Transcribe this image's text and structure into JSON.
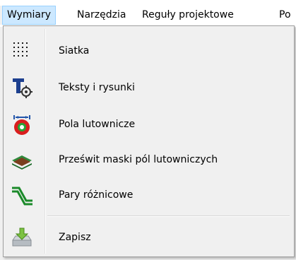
{
  "menubar": {
    "items": [
      {
        "label": "Wymiary",
        "active": true
      },
      {
        "label": "Narzędzia"
      },
      {
        "label": "Reguły projektowe"
      },
      {
        "label": "Po"
      }
    ]
  },
  "dropdown": {
    "items": [
      {
        "label": "Siatka",
        "icon": "grid-dots-icon"
      },
      {
        "label": "Teksty i rysunki",
        "icon": "text-gear-icon"
      },
      {
        "label": "Pola lutownicze",
        "icon": "solder-pad-icon"
      },
      {
        "label": "Prześwit maski pól lutowniczych",
        "icon": "mask-layers-icon"
      },
      {
        "label": "Pary różnicowe",
        "icon": "diff-pair-icon"
      },
      {
        "label": "Zapisz",
        "icon": "save-tray-icon"
      }
    ]
  },
  "colors": {
    "menu_highlight": "#cce8ff",
    "menu_highlight_border": "#99d1ff",
    "menu_background": "#f0f0f0"
  }
}
